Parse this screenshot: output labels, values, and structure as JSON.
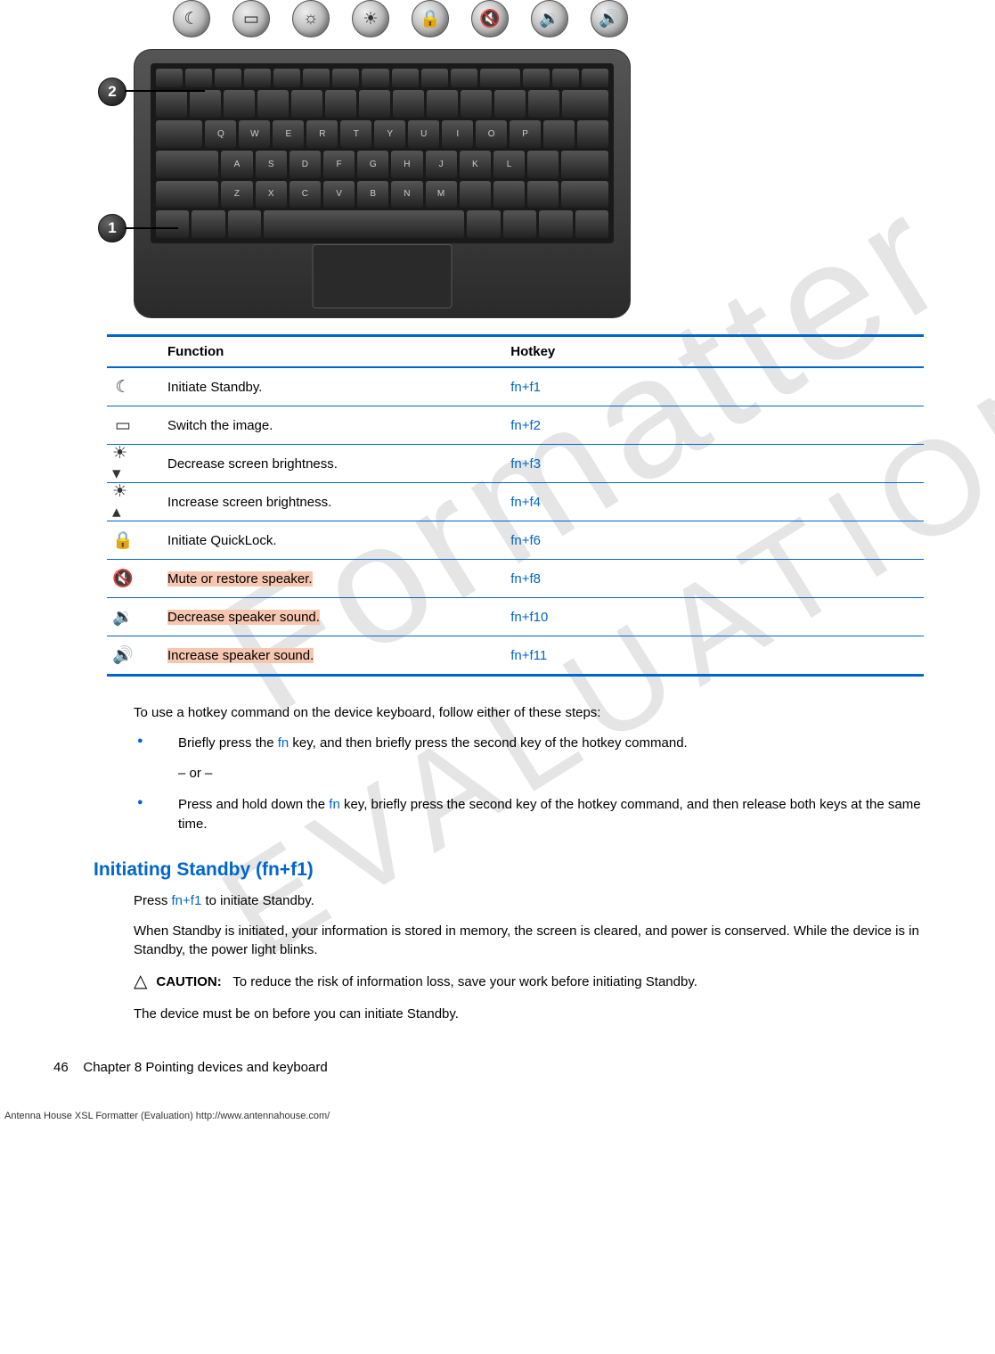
{
  "table": {
    "headers": {
      "func": "Function",
      "hotkey": "Hotkey"
    },
    "rows": [
      {
        "func": "Initiate Standby.",
        "hotkey": "fn+f1",
        "hl": false,
        "icon": "moon-icon",
        "glyph": "☾"
      },
      {
        "func": "Switch the image.",
        "hotkey": "fn+f2",
        "hl": false,
        "icon": "display-icon",
        "glyph": "▭"
      },
      {
        "func": "Decrease screen brightness.",
        "hotkey": "fn+f3",
        "hl": false,
        "icon": "brightness-down-icon",
        "glyph": "☀▾"
      },
      {
        "func": "Increase screen brightness.",
        "hotkey": "fn+f4",
        "hl": false,
        "icon": "brightness-up-icon",
        "glyph": "☀▴"
      },
      {
        "func": "Initiate QuickLock.",
        "hotkey": "fn+f6",
        "hl": false,
        "icon": "lock-icon",
        "glyph": "🔒"
      },
      {
        "func": "Mute or restore speaker.",
        "hotkey": "fn+f8",
        "hl": true,
        "icon": "mute-icon",
        "glyph": "🔇"
      },
      {
        "func": "Decrease speaker sound.",
        "hotkey": "fn+f10",
        "hl": true,
        "icon": "volume-down-icon",
        "glyph": "🔉"
      },
      {
        "func": "Increase speaker sound.",
        "hotkey": "fn+f11",
        "hl": true,
        "icon": "volume-up-icon",
        "glyph": "🔊"
      }
    ]
  },
  "intro": "To use a hotkey command on the device keyboard, follow either of these steps:",
  "bullet1_a": "Briefly press the ",
  "bullet1_fn": "fn",
  "bullet1_b": " key, and then briefly press the second key of the hotkey command.",
  "bullet1_or": "– or –",
  "bullet2_a": "Press and hold down the ",
  "bullet2_fn": "fn",
  "bullet2_b": " key, briefly press the second key of the hotkey command, and then release both keys at the same time.",
  "heading": "Initiating Standby (fn+f1)",
  "p1_a": "Press ",
  "p1_fn": "fn+f1",
  "p1_b": " to initiate Standby.",
  "p2": "When Standby is initiated, your information is stored in memory, the screen is cleared, and power is conserved. While the device is in Standby, the power light blinks.",
  "caution_label": "CAUTION:",
  "caution_text": "To reduce the risk of information loss, save your work before initiating Standby.",
  "p3": "The device must be on before you can initiate Standby.",
  "footer_page": "46",
  "footer_chapter": "Chapter 8   Pointing devices and keyboard",
  "antenna": "Antenna House XSL Formatter (Evaluation)  http://www.antennahouse.com/",
  "watermark1": "Formatter",
  "watermark2": "EVALUATION"
}
